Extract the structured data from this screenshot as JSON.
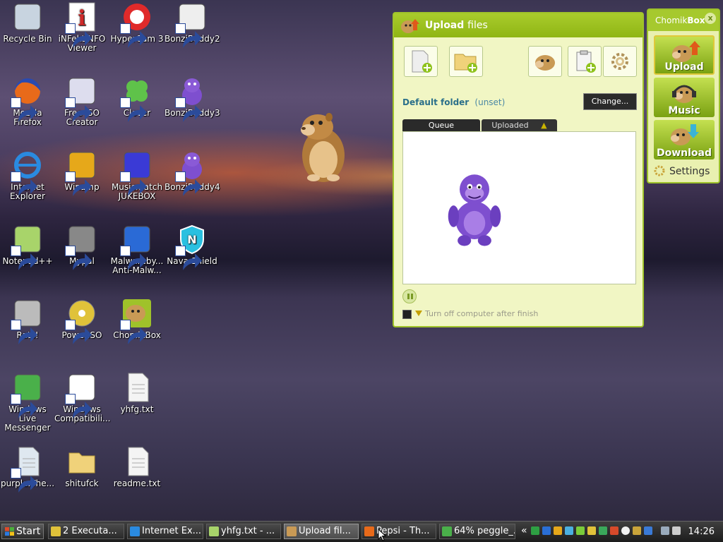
{
  "desktop": {
    "icons": [
      {
        "id": "recycle-bin",
        "label": "Recycle Bin",
        "icon": "recycle-bin-icon",
        "shortcut": false
      },
      {
        "id": "infekt",
        "label": "iNFekt NFO Viewer",
        "icon": "info-icon",
        "shortcut": true
      },
      {
        "id": "hypercam",
        "label": "HyperCam 3",
        "icon": "record-icon",
        "shortcut": true
      },
      {
        "id": "bonzi2",
        "label": "BonziBuddy2",
        "icon": "clapperboard-icon",
        "shortcut": true
      },
      {
        "id": "firefox",
        "label": "Mozilla Firefox",
        "icon": "firefox-icon",
        "shortcut": true
      },
      {
        "id": "freeiso",
        "label": "Free ISO Creator",
        "icon": "window-app-icon",
        "shortcut": true
      },
      {
        "id": "clover",
        "label": "Clover",
        "icon": "clover-icon",
        "shortcut": true
      },
      {
        "id": "bonzi3",
        "label": "BonziBuddy3",
        "icon": "bonzi-icon",
        "shortcut": true
      },
      {
        "id": "ie",
        "label": "Internet Explorer",
        "icon": "internet-explorer-icon",
        "shortcut": true
      },
      {
        "id": "winamp",
        "label": "Winamp",
        "icon": "winamp-icon",
        "shortcut": true
      },
      {
        "id": "musicmatch",
        "label": "Musicmatch JUKEBOX",
        "icon": "music-note-icon",
        "shortcut": true
      },
      {
        "id": "bonzi4",
        "label": "BonziBuddy4",
        "icon": "bonzi-icon",
        "shortcut": true
      },
      {
        "id": "notepadpp",
        "label": "Notepad++",
        "icon": "notepad-icon",
        "shortcut": true
      },
      {
        "id": "mypal",
        "label": "Mypal",
        "icon": "raccoon-icon",
        "shortcut": true
      },
      {
        "id": "malwarebytes",
        "label": "Malwareby... Anti-Malw...",
        "icon": "malwarebytes-icon",
        "shortcut": true
      },
      {
        "id": "navashield",
        "label": "Nava Shield",
        "icon": "shield-icon",
        "shortcut": true
      },
      {
        "id": "rats",
        "label": "Rats!",
        "icon": "rat-icon",
        "shortcut": true
      },
      {
        "id": "poweriso",
        "label": "PowerISO",
        "icon": "disc-icon",
        "shortcut": true
      },
      {
        "id": "chomikbox",
        "label": "ChomikBox",
        "icon": "hamster-icon",
        "shortcut": true
      },
      {
        "id": "wlm",
        "label": "Windows Live Messenger",
        "icon": "messenger-icon",
        "shortcut": true
      },
      {
        "id": "wincompat",
        "label": "Windows Compatibili...",
        "icon": "firefox-doc-icon",
        "shortcut": true
      },
      {
        "id": "yhfg",
        "label": "yhfg.txt",
        "icon": "text-file-icon",
        "shortcut": false
      },
      {
        "id": "purple",
        "label": "purple.The...",
        "icon": "document-icon",
        "shortcut": true
      },
      {
        "id": "shitufck",
        "label": "shitufck",
        "icon": "folder-icon",
        "shortcut": false
      },
      {
        "id": "readme",
        "label": "readme.txt",
        "icon": "text-file-icon",
        "shortcut": false
      }
    ]
  },
  "upload_window": {
    "title_bold": "Upload",
    "title_rest": "files",
    "default_folder_label": "Default folder",
    "default_folder_value": "(unset)",
    "change_button": "Change...",
    "tabs": {
      "queue": "Queue",
      "uploaded": "Uploaded"
    },
    "turn_off_label": "Turn off computer after finish"
  },
  "side_panel": {
    "brand_plain": "Chomik",
    "brand_bold": "Box",
    "close": "x",
    "buttons": {
      "upload": "Upload",
      "music": "Music",
      "download": "Download"
    },
    "settings": "Settings"
  },
  "taskbar": {
    "start": "Start",
    "tasks": [
      {
        "label": "2 Executa...",
        "icon": "group-icon"
      },
      {
        "label": "Internet Ex...",
        "icon": "internet-explorer-icon"
      },
      {
        "label": "yhfg.txt - ...",
        "icon": "notepad-icon"
      },
      {
        "label": "Upload fil...",
        "icon": "hamster-icon"
      },
      {
        "label": "Pepsi - Th...",
        "icon": "browser-icon"
      },
      {
        "label": "64% peggle_...",
        "icon": "download-icon"
      }
    ],
    "tray_chevron": "«",
    "clock": "14:26"
  },
  "colors": {
    "accent_green": "#9fc22a",
    "title_green": "#8fb514",
    "link_blue": "#2a6f8a",
    "bonzi_purple": "#7e4fcf",
    "hamster_brown": "#c99a55"
  }
}
